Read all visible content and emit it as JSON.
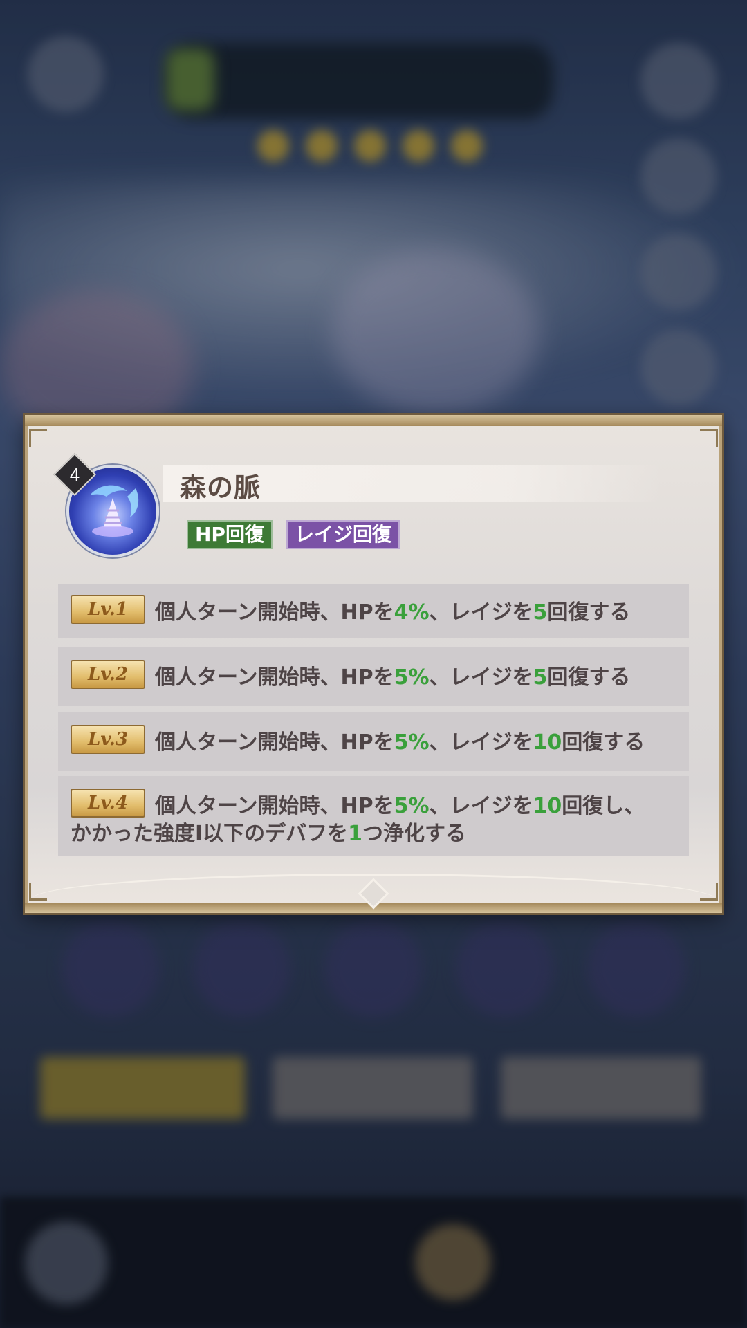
{
  "skill": {
    "name": "森の脈",
    "level_badge": "4",
    "tags": [
      "HP回復",
      "レイジ回復"
    ]
  },
  "levels": [
    {
      "badge": "Lv.1",
      "parts": [
        "個人ターン開始時、HPを",
        "4%",
        "、レイジを",
        "5",
        "回復する"
      ]
    },
    {
      "badge": "Lv.2",
      "parts": [
        "個人ターン開始時、HPを",
        "5%",
        "、レイジを",
        "5",
        "回復する"
      ]
    },
    {
      "badge": "Lv.3",
      "parts": [
        "個人ターン開始時、HPを",
        "5%",
        "、レイジを",
        "10",
        "回復する"
      ]
    },
    {
      "badge": "Lv.4",
      "parts": [
        "個人ターン開始時、HPを",
        "5%",
        "、レイジを",
        "10",
        "回復し、"
      ],
      "line2": [
        "かかった強度Ⅰ以下のデバフを",
        "1",
        "つ浄化する"
      ]
    }
  ],
  "colors": {
    "highlight_green": "#3aa03b",
    "tag_green": "#3d7a35",
    "tag_purple": "#7b52a6",
    "text": "#4e4446",
    "title_text": "#5c4c44"
  },
  "icons": {
    "skill_icon": "dolphin-shell-icon"
  }
}
